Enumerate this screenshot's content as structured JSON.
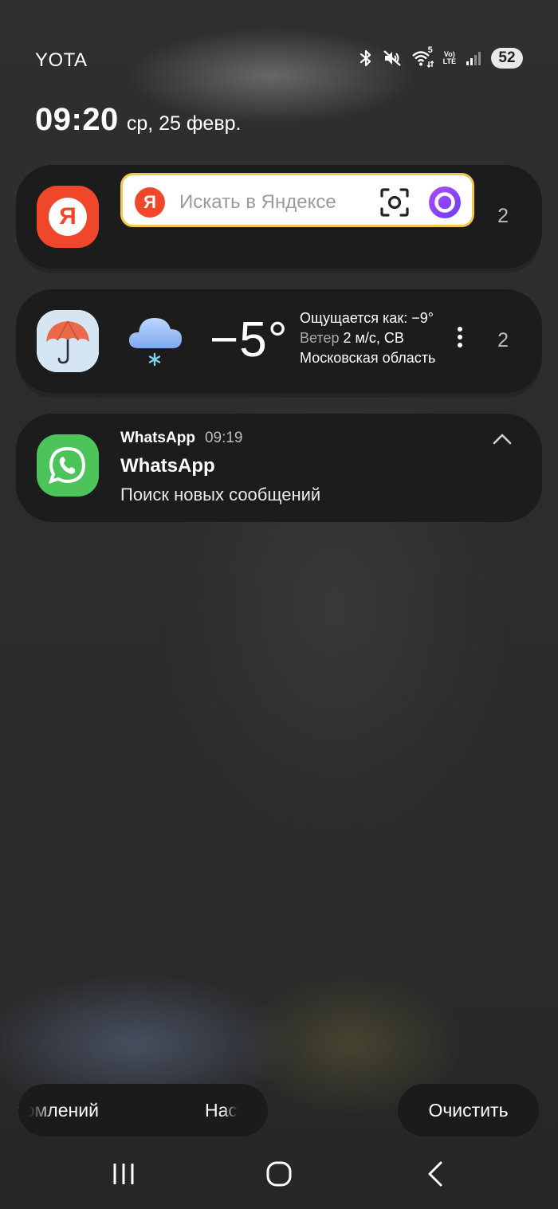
{
  "status_bar": {
    "carrier": "YOTA",
    "network_sup": "5",
    "volte_top": "Vo)",
    "volte_bottom": "LTE",
    "battery": "52",
    "icons": [
      "bluetooth-icon",
      "mute-icon",
      "wifi-icon",
      "volte-icon",
      "signal-icon",
      "battery-icon"
    ]
  },
  "clock": {
    "time": "09:20",
    "date": "ср, 25 февр."
  },
  "notifications": {
    "yandex": {
      "icon_letter": "Я",
      "search_letter": "Я",
      "search_placeholder": "Искать в Яндексе",
      "count": "2",
      "colors": {
        "brand": "#f0472b",
        "border": "#f1c84b",
        "alice": "#8a3ffc"
      }
    },
    "weather": {
      "temperature": "−5°",
      "feels_like": "Ощущается как: −9°",
      "wind_label": "Ветер",
      "wind_value": "2 м/с, СВ",
      "location": "Московская область",
      "count": "2"
    },
    "whatsapp": {
      "app_name": "WhatsApp",
      "time": "09:19",
      "title": "WhatsApp",
      "text": "Поиск новых сообщений",
      "colors": {
        "brand": "#4cc45a"
      }
    }
  },
  "bottom_buttons": {
    "left_text_1": "едомлений",
    "left_text_2": "Нас",
    "clear_label": "Очистить"
  }
}
